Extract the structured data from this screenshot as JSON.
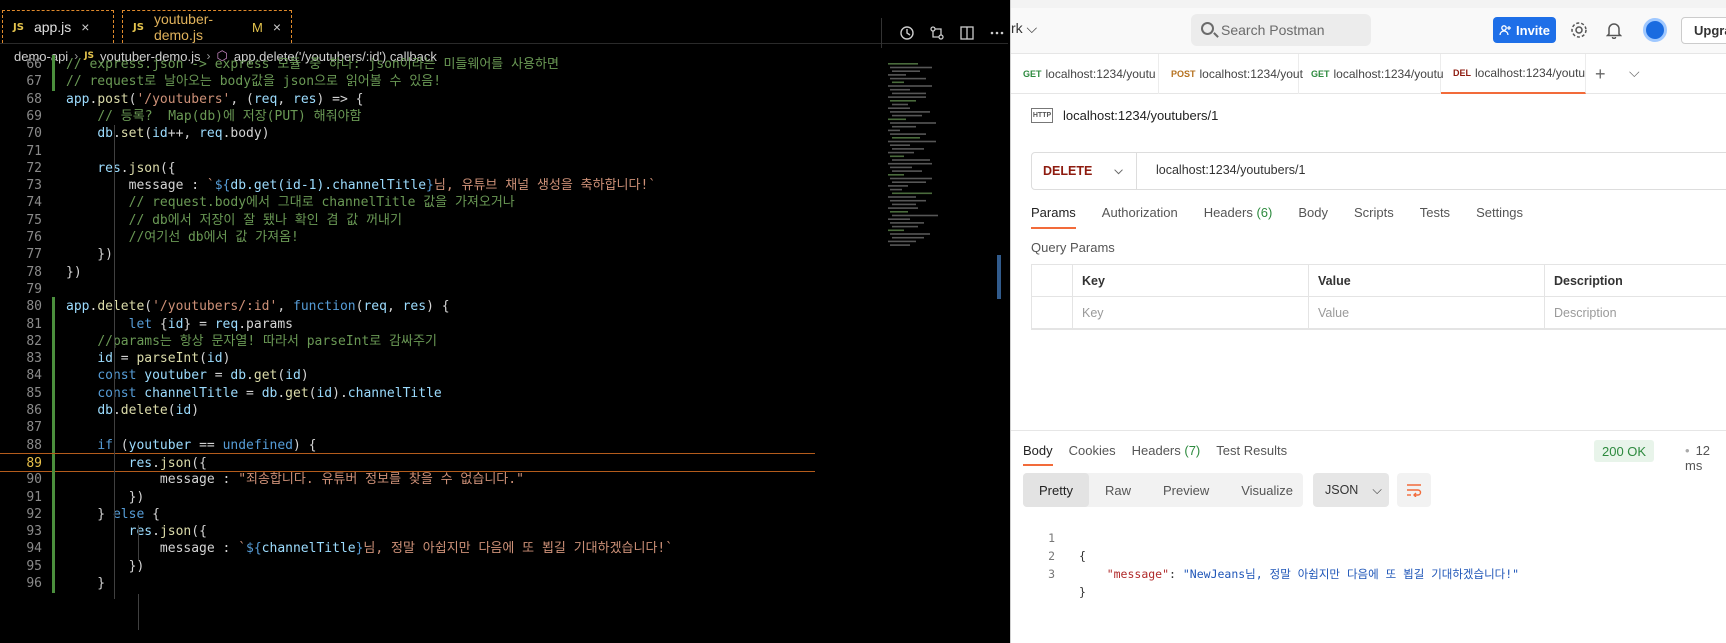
{
  "vscode": {
    "tabs": [
      {
        "badge": "JS",
        "label": "app.js",
        "close": "×"
      },
      {
        "badge": "JS",
        "label": "youtuber-demo.js",
        "modified": "M",
        "close": "×"
      }
    ],
    "breadcrumb": [
      "demo-api",
      "youtuber-demo.js",
      "app.delete('/youtubers/:id') callback"
    ],
    "breadcrumb_badge": "JS",
    "tools": [
      "history-icon",
      "compare-icon",
      "split-editor-icon",
      "more-icon"
    ],
    "code_lines": [
      {
        "n": 66,
        "t": "// express.json -> express 모듈 중 하나: json이라는 미들웨어를 사용하면",
        "gut": "add"
      },
      {
        "n": 67,
        "t": "// request로 날아오는 body값을 json으로 읽어볼 수 있음!",
        "gut": "add"
      },
      {
        "n": 68,
        "t": "app.post('/youtubers', (req, res) => {",
        "gut": ""
      },
      {
        "n": 69,
        "t": "    // 등록?  Map(db)에 저장(PUT) 해줘야함",
        "gut": ""
      },
      {
        "n": 70,
        "t": "    db.set(id++, req.body)",
        "gut": ""
      },
      {
        "n": 71,
        "t": "",
        "gut": ""
      },
      {
        "n": 72,
        "t": "    res.json({",
        "gut": ""
      },
      {
        "n": 73,
        "t": "        message : `${db.get(id-1).channelTitle}님, 유튜브 채널 생성을 축하합니다!`",
        "gut": ""
      },
      {
        "n": 74,
        "t": "        // request.body에서 그대로 channelTitle 값을 가져오거나",
        "gut": ""
      },
      {
        "n": 75,
        "t": "        // db에서 저장이 잘 됐나 확인 겸 값 꺼내기",
        "gut": ""
      },
      {
        "n": 76,
        "t": "        //여기선 db에서 값 가져옴!",
        "gut": ""
      },
      {
        "n": 77,
        "t": "    })",
        "gut": ""
      },
      {
        "n": 78,
        "t": "})",
        "gut": ""
      },
      {
        "n": 79,
        "t": "",
        "gut": ""
      },
      {
        "n": 80,
        "t": "app.delete('/youtubers/:id', function(req, res) {",
        "gut": "add"
      },
      {
        "n": 81,
        "t": "        let {id} = req.params",
        "gut": "add"
      },
      {
        "n": 82,
        "t": "    //params는 항상 문자열! 따라서 parseInt로 감싸주기",
        "gut": "add"
      },
      {
        "n": 83,
        "t": "    id = parseInt(id)",
        "gut": "add"
      },
      {
        "n": 84,
        "t": "    const youtuber = db.get(id)",
        "gut": "add"
      },
      {
        "n": 85,
        "t": "    const channelTitle = db.get(id).channelTitle",
        "gut": "add"
      },
      {
        "n": 86,
        "t": "    db.delete(id)",
        "gut": "add"
      },
      {
        "n": 87,
        "t": "",
        "gut": "add"
      },
      {
        "n": 88,
        "t": "    if (youtuber == undefined) {",
        "gut": "add"
      },
      {
        "n": 89,
        "t": "        res.json({",
        "gut": "add"
      },
      {
        "n": 90,
        "t": "            message : \"죄송합니다. 유튜버 정보를 찾을 수 없습니다.\"",
        "gut": "add"
      },
      {
        "n": 91,
        "t": "        })",
        "gut": "add"
      },
      {
        "n": 92,
        "t": "    } else {",
        "gut": "add"
      },
      {
        "n": 93,
        "t": "        res.json({",
        "gut": "add"
      },
      {
        "n": 94,
        "t": "            message : `${channelTitle}님, 정말 아쉽지만 다음에 또 뵙길 기대하겠습니다!`",
        "gut": "add"
      },
      {
        "n": 95,
        "t": "        })",
        "gut": "add"
      },
      {
        "n": 96,
        "t": "    }",
        "gut": "add"
      }
    ],
    "current_line": 89
  },
  "postman": {
    "workspace_label": "rk ⌵",
    "search_placeholder": "Search Postman",
    "invite_label": "Invite",
    "upgrade_label": "Upgra",
    "request_tabs": [
      {
        "method": "GET",
        "label": "localhost:1234/youtu",
        "dot": true,
        "method_color": "#2d8a3e"
      },
      {
        "method": "POST",
        "label": "localhost:1234/yout",
        "dot": false,
        "method_color": "#b5711f"
      },
      {
        "method": "GET",
        "label": "localhost:1234/youtu",
        "dot": false,
        "method_color": "#2d8a3e"
      },
      {
        "method": "DEL",
        "label": "localhost:1234/youtu",
        "dot": true,
        "method_color": "#8e1b0f",
        "active": true
      }
    ],
    "tab_plus": "+",
    "tab_more": "⌵",
    "http_badge": "HTTP",
    "request_title": "localhost:1234/youtubers/1",
    "method": "DELETE",
    "url": "localhost:1234/youtubers/1",
    "request_tabs_bar": [
      "Params",
      "Authorization",
      "Headers",
      "Body",
      "Scripts",
      "Tests",
      "Settings"
    ],
    "headers_count": "(6)",
    "query_params_label": "Query Params",
    "qp_headers": [
      "Key",
      "Value",
      "Description"
    ],
    "qp_placeholders": [
      "Key",
      "Value",
      "Description"
    ],
    "response_tabs": [
      "Body",
      "Cookies",
      "Headers",
      "Test Results"
    ],
    "response_headers_count": "(7)",
    "status": "200 OK",
    "time": "12 ms",
    "view_tabs": [
      "Pretty",
      "Raw",
      "Preview",
      "Visualize"
    ],
    "format": "JSON",
    "response_body": {
      "line1": "{",
      "key": "\"message\"",
      "colon": ": ",
      "value": "\"NewJeans님, 정말 아쉽지만 다음에 또 뵙길 기대하겠습니다!\"",
      "line3": "}"
    },
    "accent": "#f26b3a"
  }
}
